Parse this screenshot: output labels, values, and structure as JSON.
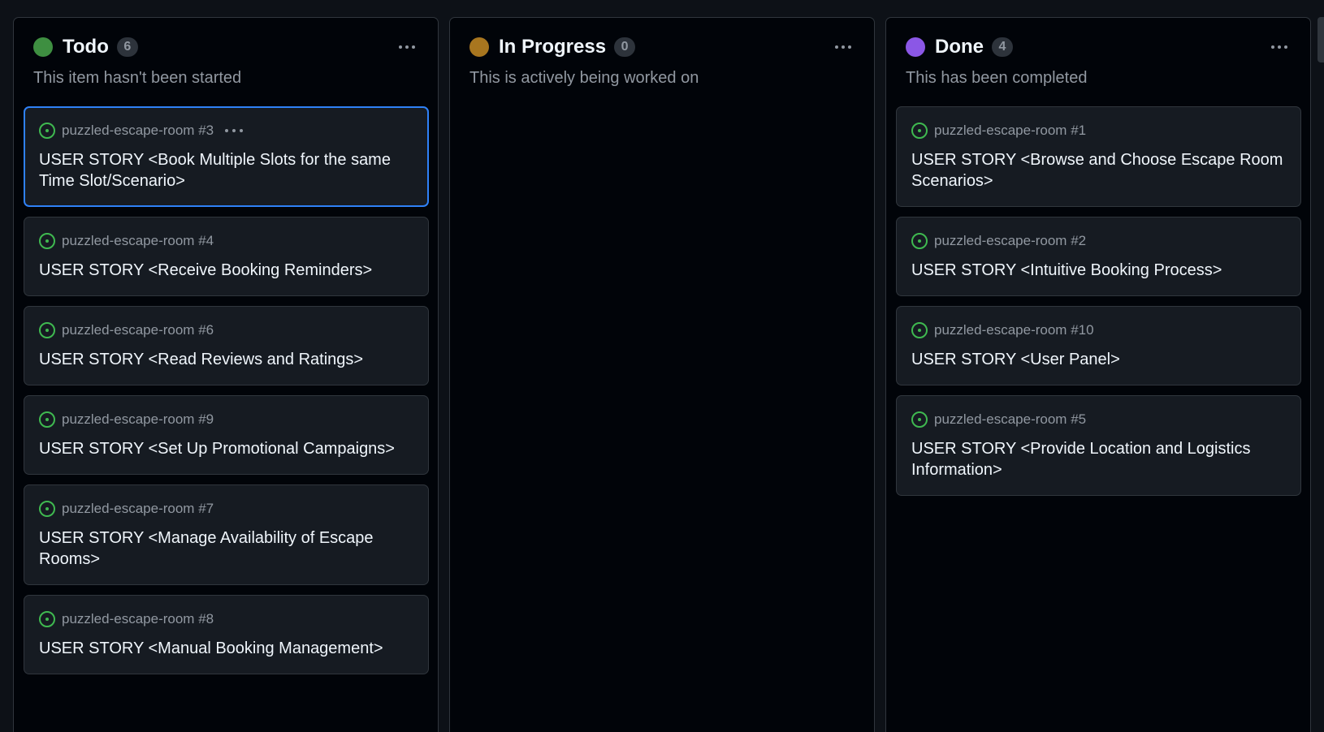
{
  "columns": {
    "todo": {
      "title": "Todo",
      "count": "6",
      "description": "This item hasn't been started",
      "dot_color": "#3e8f41",
      "cards": [
        {
          "repo": "puzzled-escape-room #3",
          "title": "USER STORY <Book Multiple Slots for the same Time Slot/Scenario>"
        },
        {
          "repo": "puzzled-escape-room #4",
          "title": "USER STORY <Receive Booking Reminders>"
        },
        {
          "repo": "puzzled-escape-room #6",
          "title": "USER STORY <Read Reviews and Ratings>"
        },
        {
          "repo": "puzzled-escape-room #9",
          "title": "USER STORY <Set Up Promotional Campaigns>"
        },
        {
          "repo": "puzzled-escape-room #7",
          "title": "USER STORY <Manage Availability of Escape Rooms>"
        },
        {
          "repo": "puzzled-escape-room #8",
          "title": "USER STORY <Manual Booking Management>"
        }
      ]
    },
    "in_progress": {
      "title": "In Progress",
      "count": "0",
      "description": "This is actively being worked on",
      "dot_color": "#a8761f",
      "cards": []
    },
    "done": {
      "title": "Done",
      "count": "4",
      "description": "This has been completed",
      "dot_color": "#8b57e6",
      "cards": [
        {
          "repo": "puzzled-escape-room #1",
          "title": "USER STORY <Browse and Choose Escape Room Scenarios>"
        },
        {
          "repo": "puzzled-escape-room #2",
          "title": "USER STORY <Intuitive Booking Process>"
        },
        {
          "repo": "puzzled-escape-room #10",
          "title": "USER STORY <User Panel>"
        },
        {
          "repo": "puzzled-escape-room #5",
          "title": "USER STORY <Provide Location and Logistics Information>"
        }
      ]
    }
  },
  "icons": {
    "issue": "issue-open-icon",
    "menu": "kebab-menu-icon"
  },
  "colors": {
    "issue_open": "#3fb950",
    "selected_border": "#2f81f7"
  }
}
